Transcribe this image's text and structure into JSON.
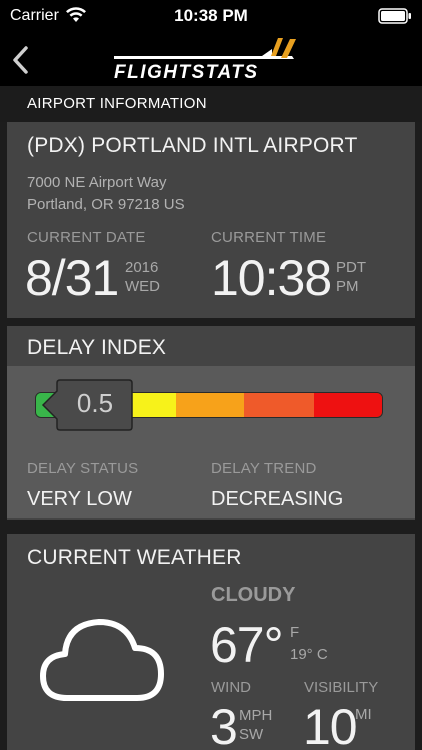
{
  "status_bar": {
    "carrier": "Carrier",
    "time": "10:38 PM"
  },
  "nav": {
    "logo_text": "FLIGHTSTATS"
  },
  "section": {
    "title": "AIRPORT INFORMATION"
  },
  "airport": {
    "name": "(PDX) PORTLAND INTL AIRPORT",
    "address_line1": "7000 NE Airport Way",
    "address_line2": "Portland, OR 97218 US",
    "date_label": "CURRENT DATE",
    "date": "8/31",
    "year": "2016",
    "weekday": "WED",
    "time_label": "CURRENT TIME",
    "time": "10:38",
    "timezone": "PDT",
    "ampm": "PM"
  },
  "delay": {
    "title": "DELAY INDEX",
    "value": "0.5",
    "status_label": "DELAY STATUS",
    "status": "VERY LOW",
    "trend_label": "DELAY TREND",
    "trend": "DECREASING",
    "colors": [
      "#39b54a",
      "#f7f21a",
      "#f7a21a",
      "#ef5a2a",
      "#ee1111"
    ]
  },
  "weather": {
    "title": "CURRENT WEATHER",
    "condition": "CLOUDY",
    "temp": "67°",
    "temp_unit": "F",
    "temp_c": "19° C",
    "wind_label": "WIND",
    "wind_speed": "3",
    "wind_unit": "MPH",
    "wind_dir": "SW",
    "visibility_label": "VISIBILITY",
    "visibility": "10",
    "visibility_unit": "MI",
    "icon": "cloud-icon"
  }
}
